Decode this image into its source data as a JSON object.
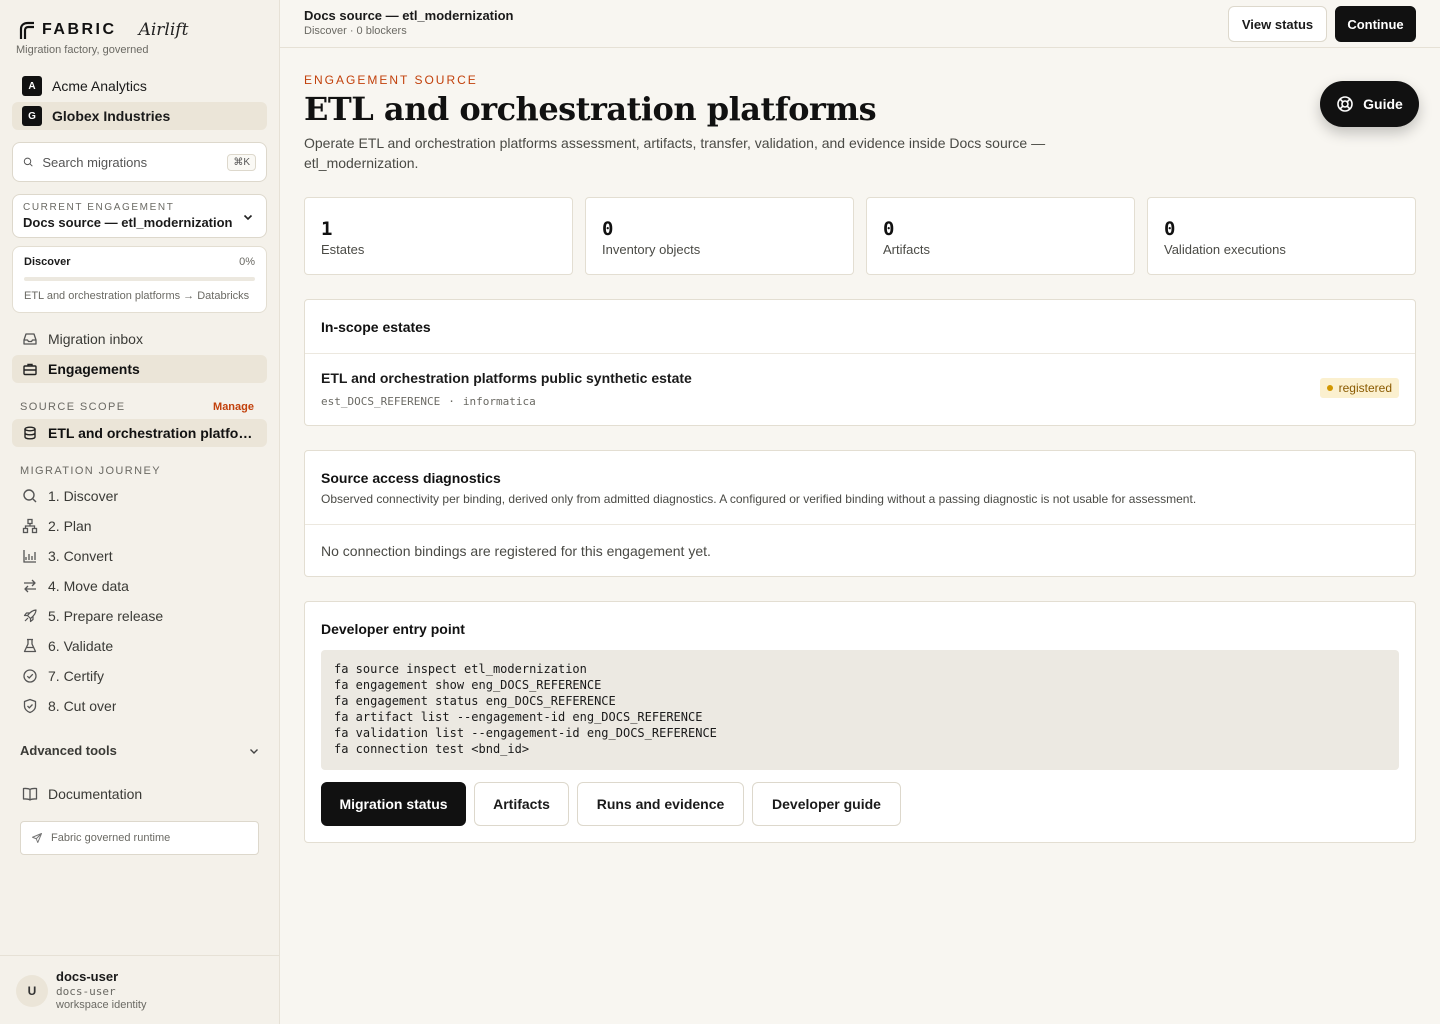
{
  "brand": {
    "name": "FABRIC",
    "product": "Airlift",
    "tagline": "Migration factory, governed"
  },
  "workspaces": [
    {
      "badge": "A",
      "label": "Acme Analytics",
      "active": false
    },
    {
      "badge": "G",
      "label": "Globex Industries",
      "active": true
    }
  ],
  "search": {
    "placeholder": "Search migrations",
    "shortcut": "⌘K"
  },
  "engagement_select": {
    "label": "CURRENT ENGAGEMENT",
    "value": "Docs source — etl_modernization"
  },
  "progress": {
    "stage": "Discover",
    "percent_label": "0%",
    "fraction": 0,
    "route": "ETL and orchestration platforms → Databricks"
  },
  "nav_primary": [
    {
      "label": "Migration inbox",
      "icon": "inbox-icon",
      "active": false
    },
    {
      "label": "Engagements",
      "icon": "briefcase-icon",
      "active": true
    }
  ],
  "source_scope": {
    "label": "SOURCE SCOPE",
    "manage": "Manage",
    "item": "ETL and orchestration platforms"
  },
  "journey": {
    "label": "MIGRATION JOURNEY",
    "steps": [
      {
        "label": "1. Discover",
        "icon": "search-icon"
      },
      {
        "label": "2. Plan",
        "icon": "hierarchy-icon"
      },
      {
        "label": "3. Convert",
        "icon": "convert-icon"
      },
      {
        "label": "4. Move data",
        "icon": "arrows-swap-icon"
      },
      {
        "label": "5. Prepare release",
        "icon": "rocket-icon"
      },
      {
        "label": "6. Validate",
        "icon": "flask-icon"
      },
      {
        "label": "7. Certify",
        "icon": "check-circle-icon"
      },
      {
        "label": "8. Cut over",
        "icon": "shield-check-icon"
      }
    ]
  },
  "advanced_tools": "Advanced tools",
  "documentation": "Documentation",
  "runtime": "Fabric governed runtime",
  "user": {
    "initial": "U",
    "name": "docs-user",
    "handle": "docs-user",
    "role": "workspace identity"
  },
  "topbar": {
    "title": "Docs source — etl_modernization",
    "subtitle": "Discover · 0 blockers",
    "view_status": "View status",
    "continue": "Continue"
  },
  "header": {
    "eyebrow": "ENGAGEMENT SOURCE",
    "title": "ETL and orchestration platforms",
    "description": "Operate ETL and orchestration platforms assessment, artifacts, transfer, validation, and evidence inside Docs source — etl_modernization.",
    "guide": "Guide"
  },
  "stats": [
    {
      "value": "1",
      "label": "Estates"
    },
    {
      "value": "0",
      "label": "Inventory objects"
    },
    {
      "value": "0",
      "label": "Artifacts"
    },
    {
      "value": "0",
      "label": "Validation executions"
    }
  ],
  "estates": {
    "title": "In-scope estates",
    "items": [
      {
        "name": "ETL and orchestration platforms public synthetic estate",
        "id": "est_DOCS_REFERENCE",
        "separator": "·",
        "platform": "informatica",
        "status": "registered"
      }
    ]
  },
  "diagnostics": {
    "title": "Source access diagnostics",
    "subtitle": "Observed connectivity per binding, derived only from admitted diagnostics. A configured or verified binding without a passing diagnostic is not usable for assessment.",
    "empty": "No connection bindings are registered for this engagement yet."
  },
  "developer": {
    "title": "Developer entry point",
    "commands": [
      "fa source inspect etl_modernization",
      "fa engagement show eng_DOCS_REFERENCE",
      "fa engagement status eng_DOCS_REFERENCE",
      "fa artifact list --engagement-id eng_DOCS_REFERENCE",
      "fa validation list --engagement-id eng_DOCS_REFERENCE",
      "fa connection test <bnd_id>"
    ],
    "buttons": [
      "Migration status",
      "Artifacts",
      "Runs and evidence",
      "Developer guide"
    ]
  },
  "colors": {
    "accent": "#c2410c",
    "primary": "#111111",
    "background": "#f8f6f1",
    "sidebar": "#f4f1ea",
    "badge_bg": "#fbf0cf"
  }
}
